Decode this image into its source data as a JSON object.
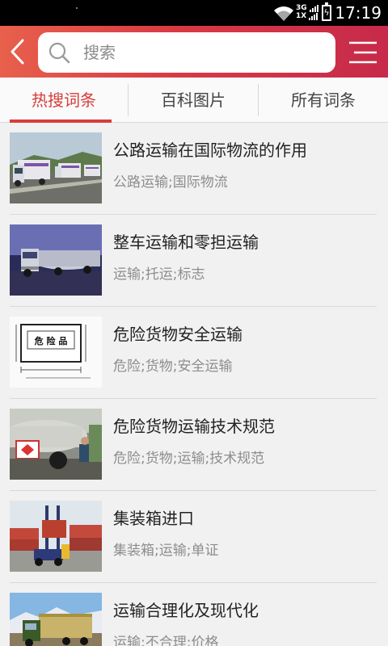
{
  "status_bar": {
    "time": "17:19",
    "network_top": "3G",
    "network_bottom": "1X"
  },
  "header": {
    "search_placeholder": "搜索",
    "accent_color": "#d93b3b"
  },
  "tabs": [
    {
      "label": "热搜词条",
      "active": true
    },
    {
      "label": "百科图片",
      "active": false
    },
    {
      "label": "所有词条",
      "active": false
    }
  ],
  "entries": [
    {
      "title": "公路运输在国际物流的作用",
      "tags": "公路运输;国际物流"
    },
    {
      "title": "整车运输和零担运输",
      "tags": "运输;托运;标志"
    },
    {
      "title": "危险货物安全运输",
      "tags": "危险;货物;安全运输",
      "image_text": "危 险 品"
    },
    {
      "title": "危险货物运输技术规范",
      "tags": "危险;货物;运输;技术规范"
    },
    {
      "title": "集装箱进口",
      "tags": "集装箱;运输;单证"
    },
    {
      "title": "运输合理化及现代化",
      "tags": "运输;不合理;价格"
    }
  ]
}
